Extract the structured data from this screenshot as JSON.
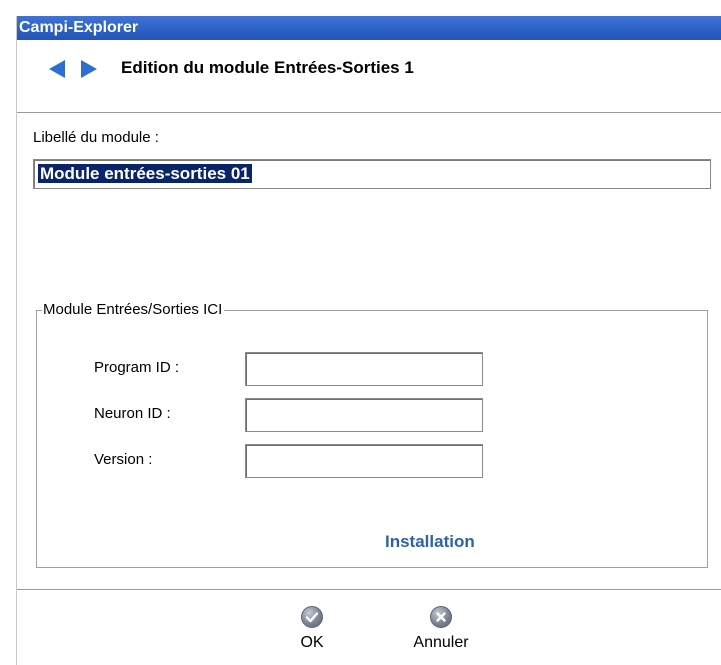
{
  "window": {
    "title": "Campi-Explorer"
  },
  "nav": {
    "back_icon": "left-arrow-icon",
    "forward_icon": "right-arrow-icon",
    "heading": "Edition du module Entrées-Sorties 1"
  },
  "form": {
    "module_label": "Libellé du module :",
    "module_value": "Module entrées-sorties 01"
  },
  "group": {
    "legend": "Module Entrées/Sorties ICI",
    "fields": [
      {
        "label": "Program ID :",
        "value": ""
      },
      {
        "label": "Neuron ID :",
        "value": ""
      },
      {
        "label": "Version :",
        "value": ""
      }
    ],
    "install_link": "Installation"
  },
  "footer": {
    "ok_label": "OK",
    "ok_icon": "check-icon",
    "cancel_label": "Annuler",
    "cancel_icon": "close-icon"
  },
  "colors": {
    "titlebar": "#2d61c6",
    "accent": "#2d6fd1",
    "link": "#2e63a8",
    "selection": "#0a246a"
  }
}
